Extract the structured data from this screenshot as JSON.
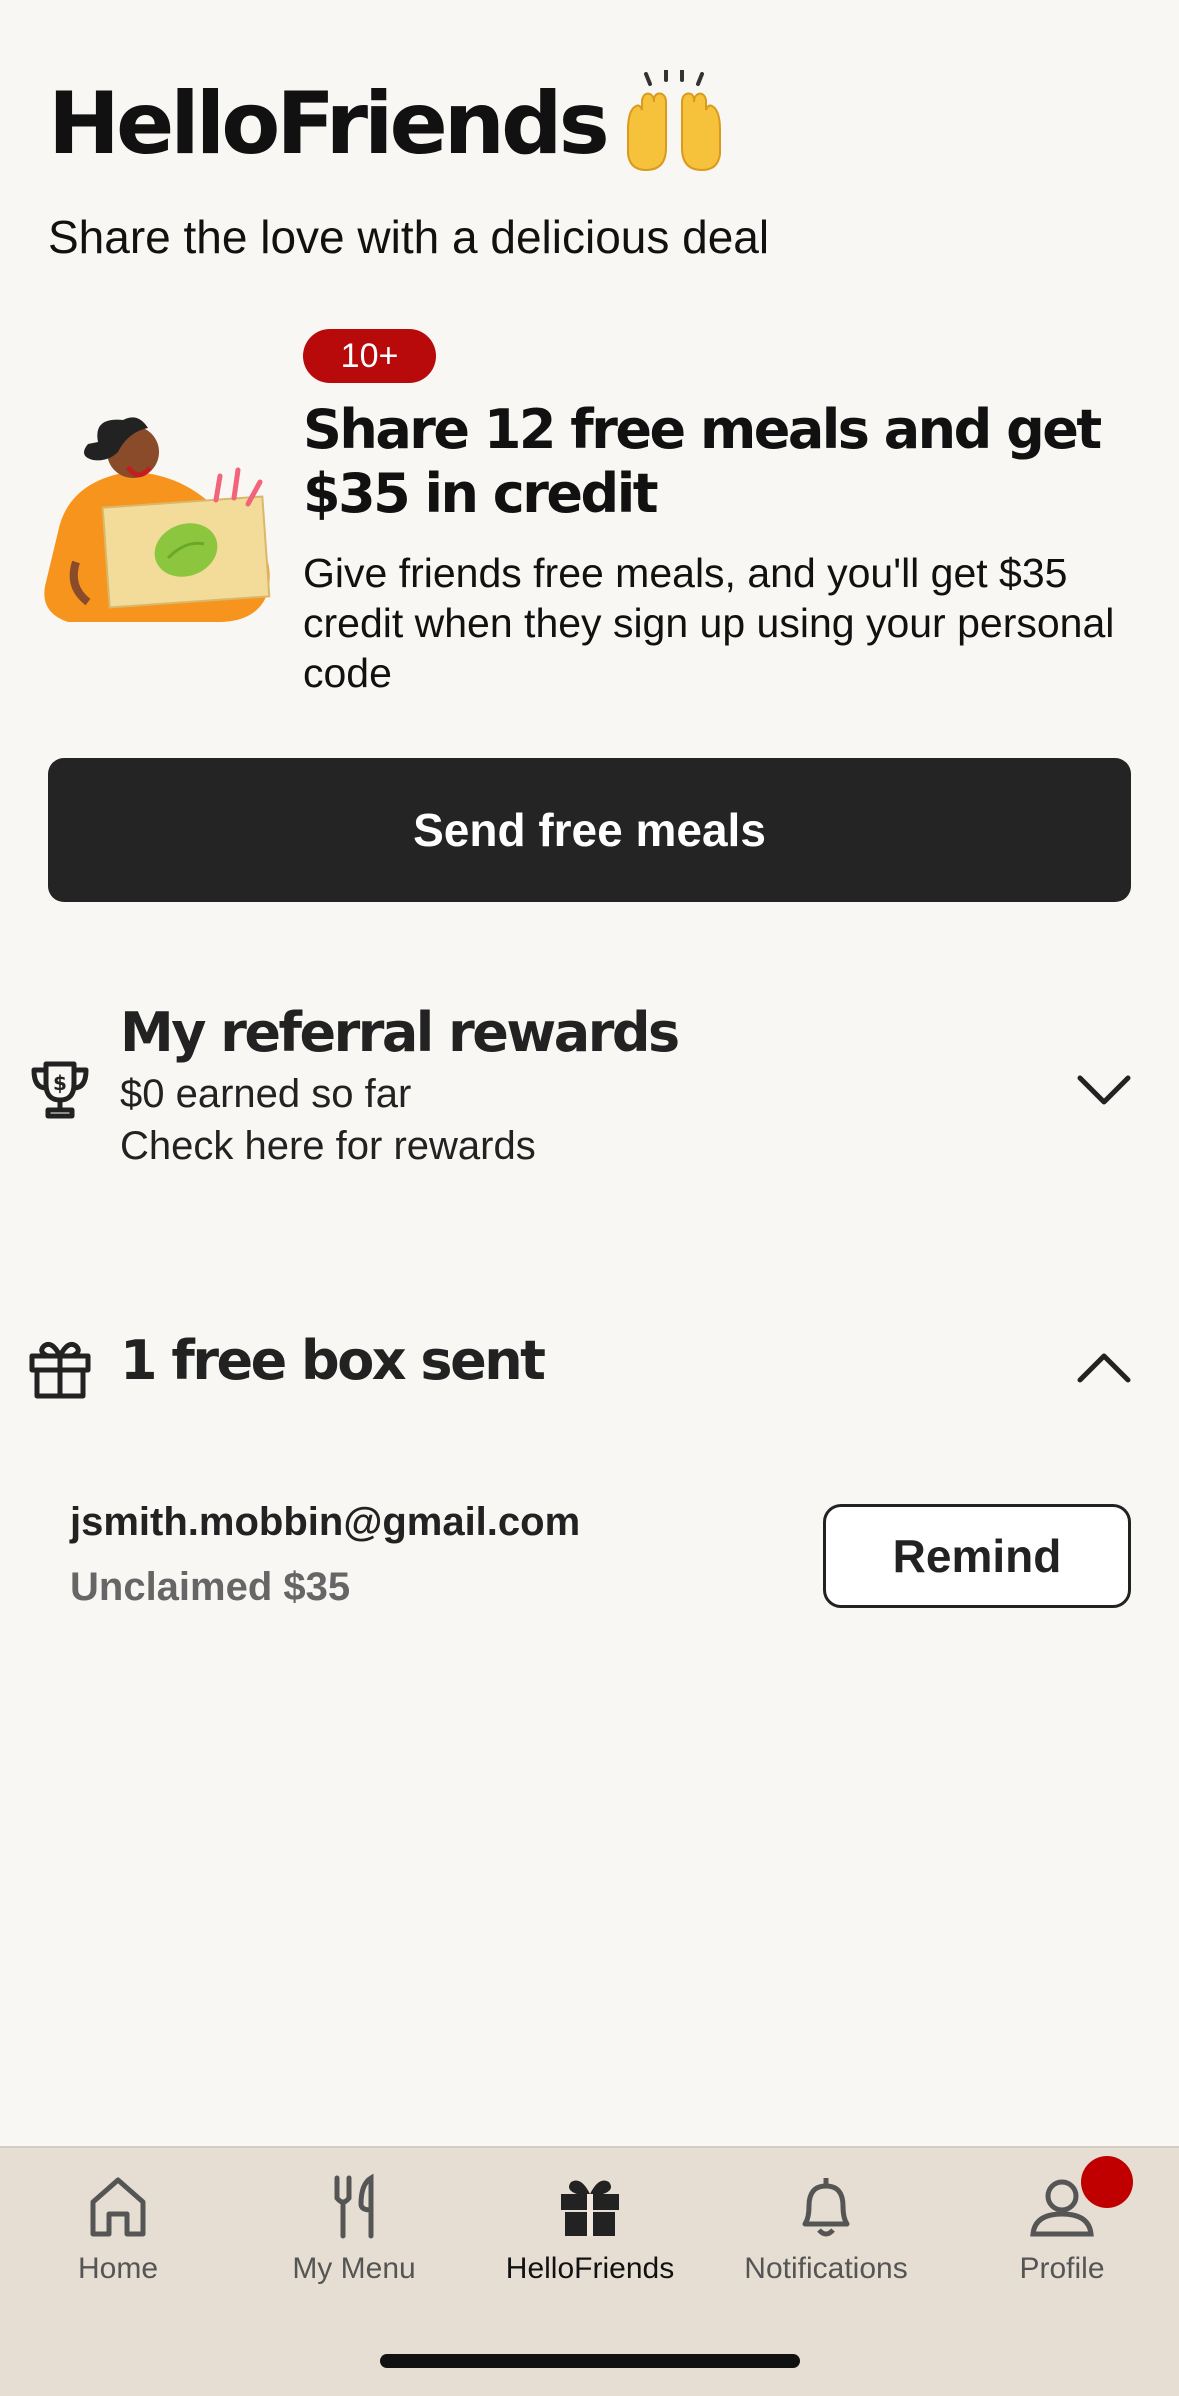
{
  "header": {
    "title": "HelloFriends",
    "subtitle": "Share the love with a delicious deal",
    "title_emoji_icon": "raising-hands-icon"
  },
  "promo": {
    "badge": "10+",
    "title": "Share 12 free meals and get $35 in credit",
    "description": "Give friends free meals, and you'll get $35 credit when they sign up using your personal code",
    "illustration": "person-holding-lime-box-illustration"
  },
  "send_button": {
    "label": "Send free meals"
  },
  "rewards": {
    "title": "My referral rewards",
    "earned": "$0 earned so far",
    "hint": "Check here for rewards",
    "icon": "trophy-icon",
    "expanded": false
  },
  "boxes_sent": {
    "title": "1 free box sent",
    "icon": "gift-icon",
    "expanded": true,
    "referrals": [
      {
        "email": "jsmith.mobbin@gmail.com",
        "status": "Unclaimed $35",
        "action": "Remind"
      }
    ]
  },
  "tabbar": {
    "tabs": [
      {
        "label": "Home",
        "icon": "home-icon",
        "active": false
      },
      {
        "label": "My Menu",
        "icon": "fork-knife-icon",
        "active": false
      },
      {
        "label": "HelloFriends",
        "icon": "gift-icon",
        "active": true
      },
      {
        "label": "Notifications",
        "icon": "bell-icon",
        "active": false
      },
      {
        "label": "Profile",
        "icon": "user-icon",
        "active": false,
        "notification_dot": true
      }
    ]
  },
  "colors": {
    "background": "#f9f7f3",
    "badge_red": "#b80a0a",
    "button_dark": "#242424",
    "tabbar_bg": "#e6ded3",
    "notification_red": "#c00000"
  }
}
